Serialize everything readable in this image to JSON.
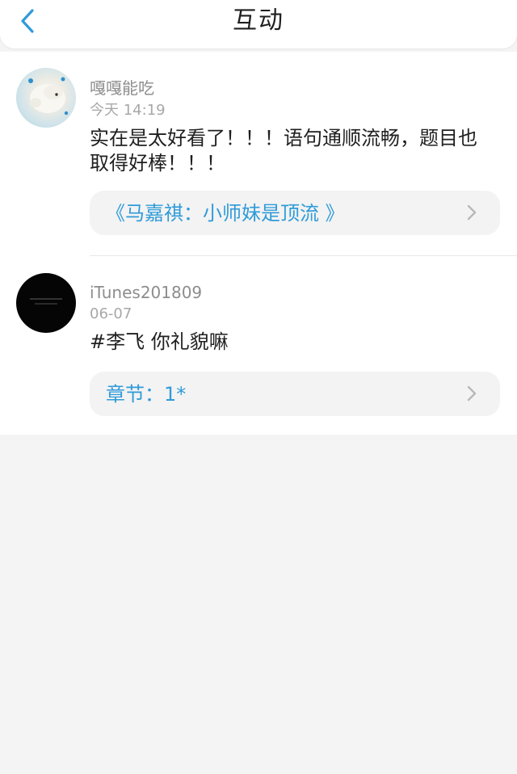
{
  "header": {
    "title": "互动"
  },
  "comments": [
    {
      "username": "嘎嘎能吃",
      "date": "今天 14:19",
      "text": "实在是太好看了！！！语句通顺流畅，题目也取得好棒！！！",
      "link": "《马嘉祺：小师妹是顶流 》"
    },
    {
      "username": "iTunes201809",
      "date": "06-07",
      "text": "#李飞 你礼貌嘛",
      "link": "章节：1*"
    }
  ],
  "colors": {
    "accent": "#2f9bd9",
    "page_bg": "#f4f4f4",
    "card_bg": "#f3f3f3"
  },
  "icons": {
    "back": "chevron-left-icon",
    "link_arrow": "chevron-right-icon"
  }
}
